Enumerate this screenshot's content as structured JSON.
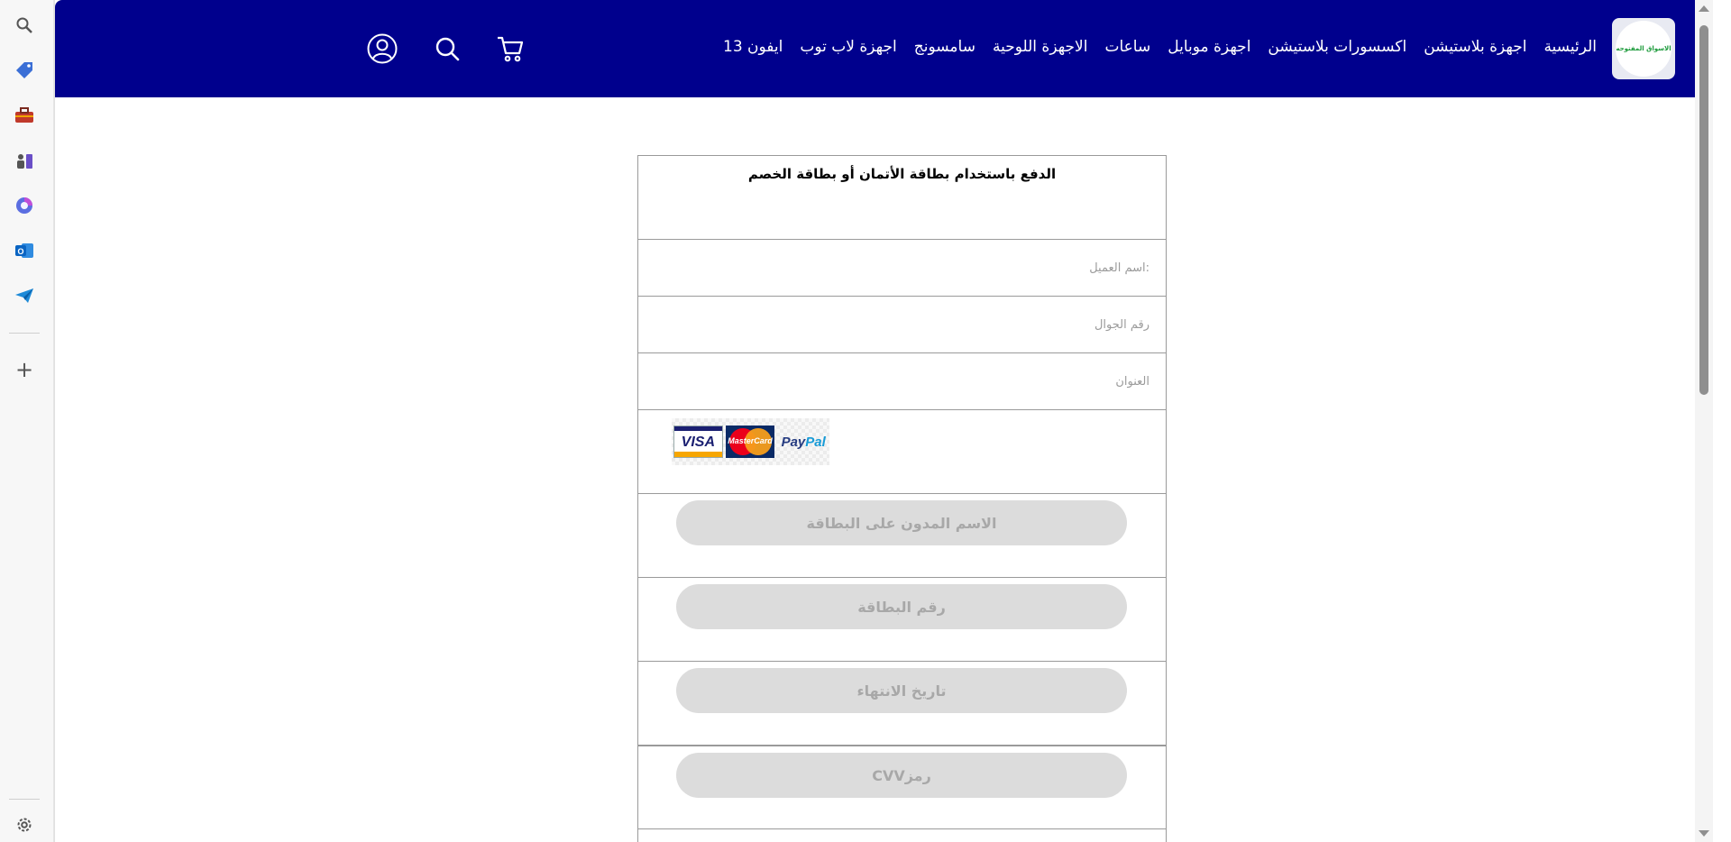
{
  "browser_sidebar": {
    "items": [
      {
        "name": "search-icon",
        "color": "#555555"
      },
      {
        "name": "tag-icon",
        "color": "#3b6fd6"
      },
      {
        "name": "toolbox-icon",
        "color": "#c0392b"
      },
      {
        "name": "chess-icon",
        "color": "#6a4fc7"
      },
      {
        "name": "copilot-icon",
        "color": "#5b6ee1"
      },
      {
        "name": "outlook-icon",
        "color": "#0a64c2"
      },
      {
        "name": "send-icon",
        "color": "#1d8ad8"
      }
    ],
    "add_label": "+",
    "settings": "gear-icon"
  },
  "header": {
    "bg_color": "#00008d",
    "logo_text": "الاسواق المفتوحه",
    "nav": [
      "الرئيسية",
      "اجهزة بلاستيشن",
      "اكسسورات بلاستيشن",
      "اجهزة موبايل",
      "ساعات",
      "الاجهزة اللوحية",
      "سامسونج",
      "اجهزة لاب توب",
      "ايفون 13"
    ],
    "icons": [
      "cart-icon",
      "search-icon",
      "user-icon"
    ]
  },
  "form": {
    "title": "الدفع باستخدام بطاقة الأتمان أو بطاقة الخصم",
    "customer_name_placeholder": ":اسم العميل",
    "phone_placeholder": "رقم الجوال",
    "address_placeholder": "العنوان",
    "cards": {
      "visa": "VISA",
      "mastercard": "MasterCard",
      "paypal_a": "Pay",
      "paypal_b": "Pal"
    },
    "card_name_placeholder": "الاسم المدون على البطاقة",
    "card_number_placeholder": "رقم البطاقة",
    "expiry_placeholder": "تاريخ الانتهاء",
    "cvv_placeholder": "رمزCVV"
  }
}
